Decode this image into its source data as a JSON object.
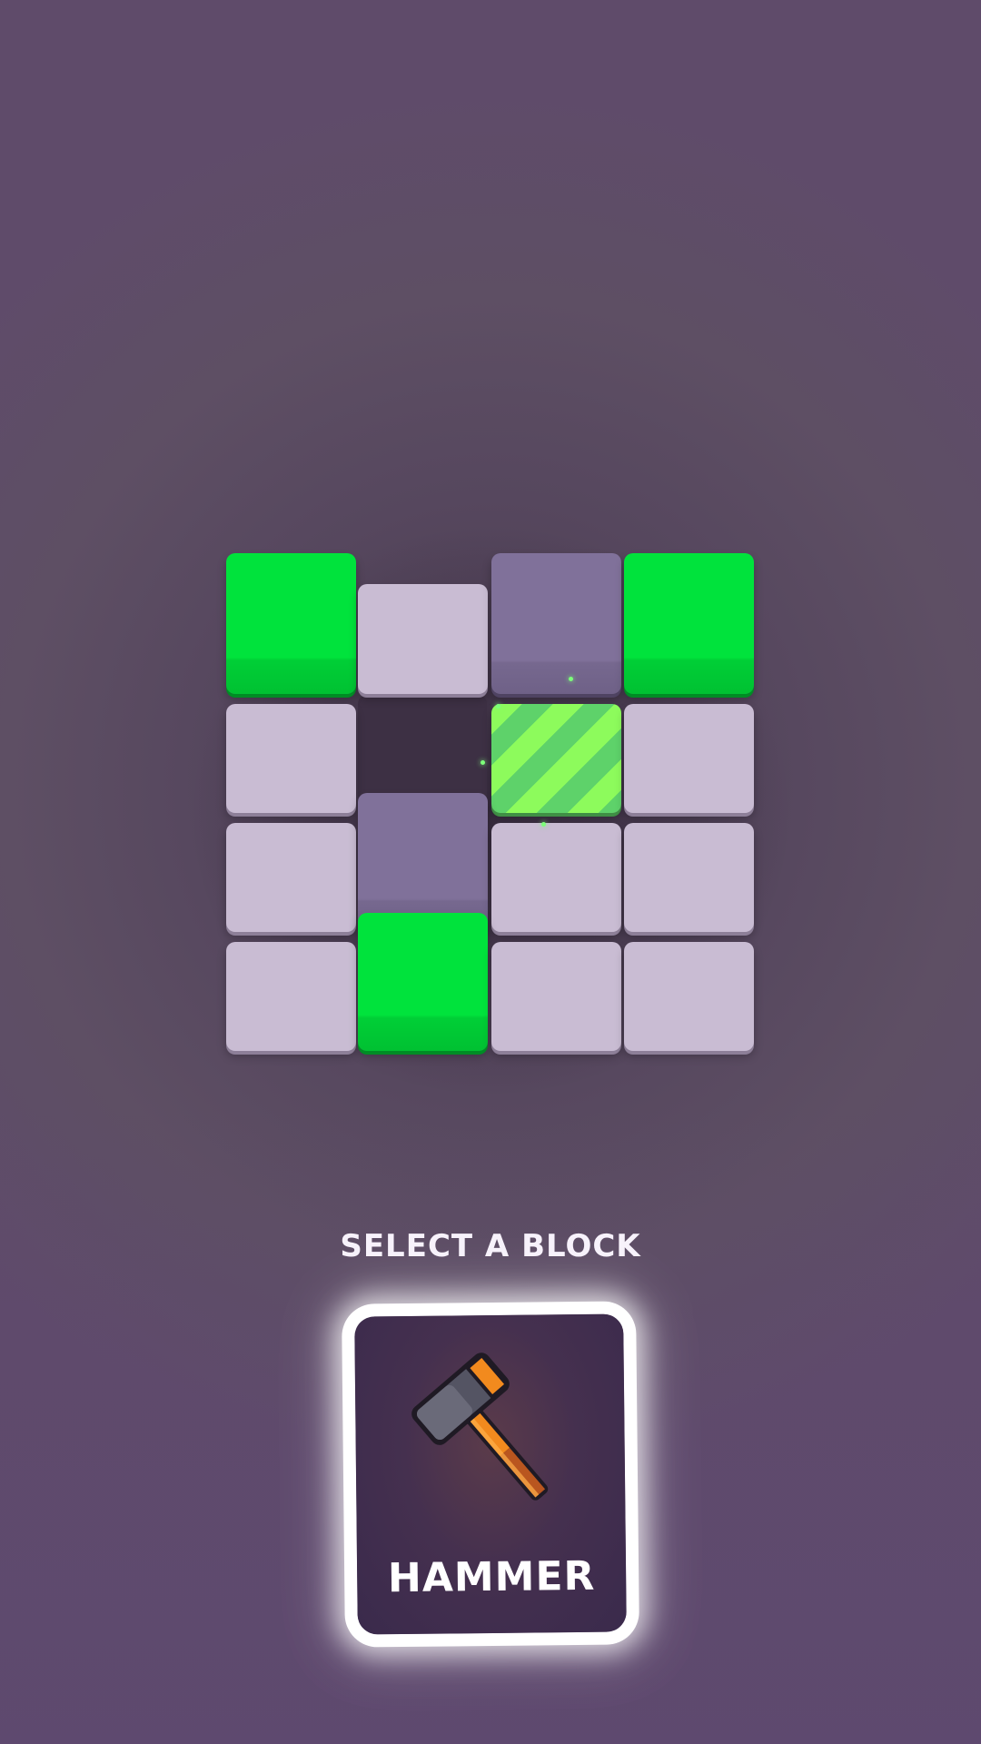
{
  "board": {
    "rows": [
      [
        "green",
        "empty",
        "gray",
        "green"
      ],
      [
        "empty",
        "hole",
        "striped",
        "empty"
      ],
      [
        "empty",
        "gray",
        "empty",
        "empty"
      ],
      [
        "empty",
        "green",
        "empty",
        "empty"
      ]
    ],
    "colors": {
      "green": "#00e33c",
      "empty": "#c9bcd3",
      "gray": "#80719a",
      "striped": "#8dfb5c"
    }
  },
  "prompt": {
    "text": "SELECT A BLOCK"
  },
  "powerup": {
    "label": "HAMMER",
    "icon": "hammer-icon",
    "selected": true
  }
}
